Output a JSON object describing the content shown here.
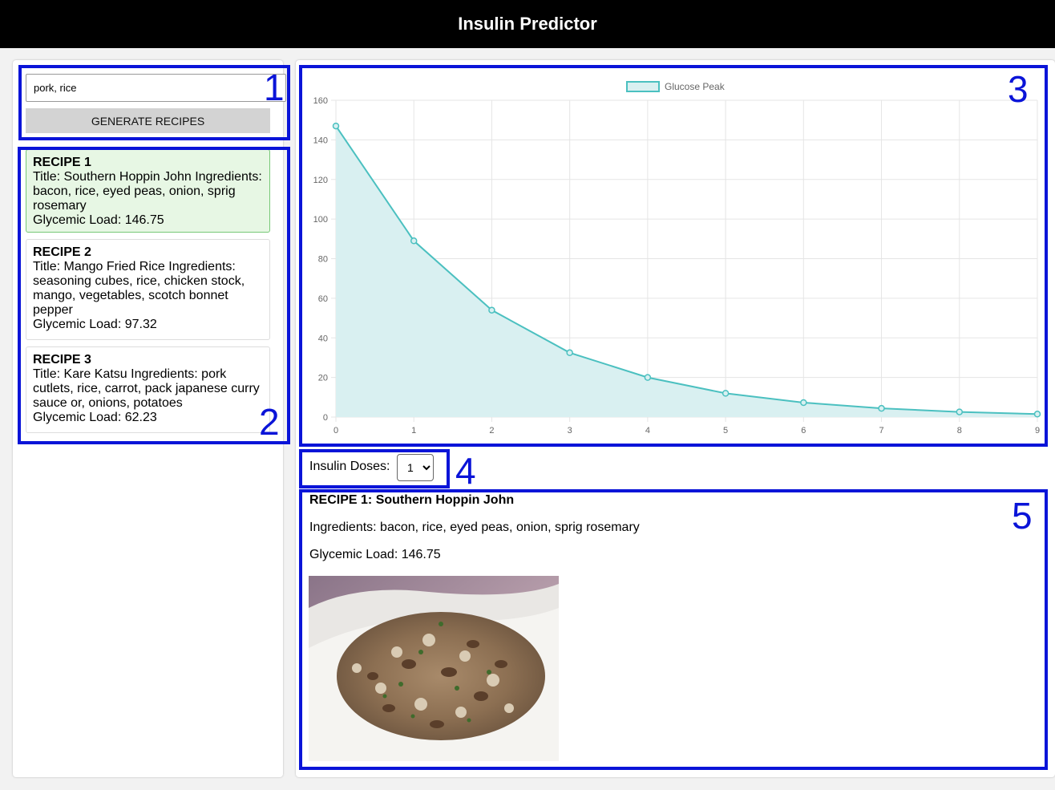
{
  "app": {
    "title": "Insulin Predictor"
  },
  "search": {
    "value": "pork, rice",
    "button_label": "GENERATE RECIPES"
  },
  "recipes": [
    {
      "label": "RECIPE 1",
      "line": "Title: Southern Hoppin John Ingredients: bacon, rice, eyed peas, onion, sprig rosemary",
      "gl": "Glycemic Load: 146.75",
      "selected": true
    },
    {
      "label": "RECIPE 2",
      "line": "Title: Mango Fried Rice Ingredients: seasoning cubes, rice, chicken stock, mango, vegetables, scotch bonnet pepper",
      "gl": "Glycemic Load: 97.32",
      "selected": false
    },
    {
      "label": "RECIPE 3",
      "line": "Title: Kare Katsu Ingredients: pork cutlets, rice, carrot, pack japanese curry sauce or, onions, potatoes",
      "gl": "Glycemic Load: 62.23",
      "selected": false
    }
  ],
  "chart_data": {
    "type": "line",
    "fill": "area",
    "series": [
      {
        "name": "Glucose Peak",
        "x": [
          0,
          1,
          2,
          3,
          4,
          5,
          6,
          7,
          8,
          9
        ],
        "values": [
          147,
          89,
          54,
          32.5,
          20,
          12,
          7.3,
          4.4,
          2.6,
          1.5
        ]
      }
    ],
    "xlim": [
      0,
      9
    ],
    "ylim": [
      0,
      160
    ],
    "yticks": [
      "0",
      "20",
      "40",
      "60",
      "80",
      "100",
      "120",
      "140",
      "160"
    ],
    "xticks": [
      "0",
      "1",
      "2",
      "3",
      "4",
      "5",
      "6",
      "7",
      "8",
      "9"
    ],
    "grid": true,
    "legend": "top-center",
    "line_color": "#4bc0c0",
    "fill_color": "#d9f0f1"
  },
  "doses": {
    "label": "Insulin Doses:",
    "value": "1",
    "options": [
      "1"
    ]
  },
  "detail": {
    "title": "RECIPE 1: Southern Hoppin John",
    "ingredients": "Ingredients: bacon, rice, eyed peas, onion, sprig rosemary",
    "gl": "Glycemic Load: 146.75"
  },
  "annotations": [
    "1",
    "2",
    "3",
    "4",
    "5"
  ],
  "colors": {
    "annotation": "#0a14d8",
    "header_bg": "#000000",
    "selected_card": "#e7f7e4"
  }
}
